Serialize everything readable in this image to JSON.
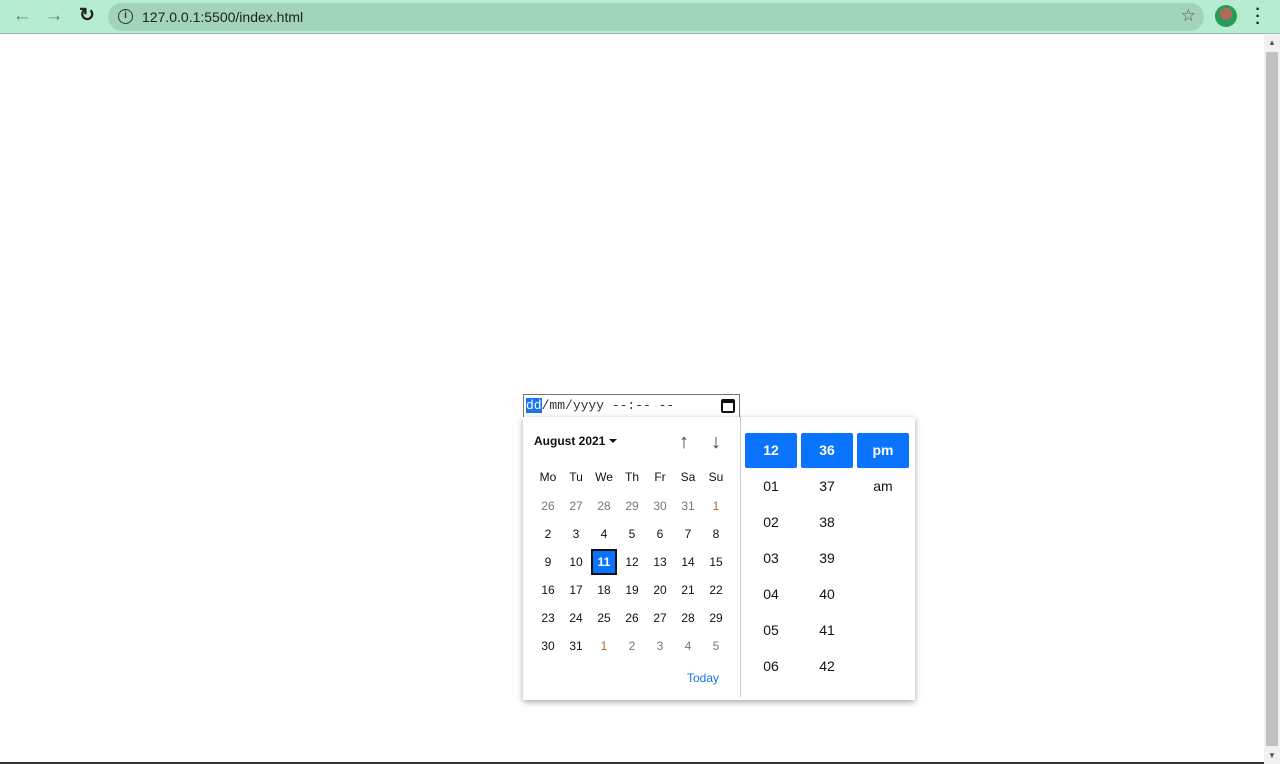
{
  "browser": {
    "url": "127.0.0.1:5500/index.html"
  },
  "input": {
    "day": "dd",
    "rest": "/mm/yyyy --:-- --"
  },
  "calendar": {
    "month_label": "August 2021",
    "weekdays": [
      "Mo",
      "Tu",
      "We",
      "Th",
      "Fr",
      "Sa",
      "Su"
    ],
    "weeks": [
      [
        {
          "d": "26",
          "t": "other"
        },
        {
          "d": "27",
          "t": "other"
        },
        {
          "d": "28",
          "t": "other"
        },
        {
          "d": "29",
          "t": "other"
        },
        {
          "d": "30",
          "t": "other"
        },
        {
          "d": "31",
          "t": "other"
        },
        {
          "d": "1",
          "t": "orange"
        }
      ],
      [
        {
          "d": "2"
        },
        {
          "d": "3"
        },
        {
          "d": "4"
        },
        {
          "d": "5"
        },
        {
          "d": "6"
        },
        {
          "d": "7"
        },
        {
          "d": "8"
        }
      ],
      [
        {
          "d": "9"
        },
        {
          "d": "10"
        },
        {
          "d": "11",
          "t": "sel"
        },
        {
          "d": "12"
        },
        {
          "d": "13"
        },
        {
          "d": "14"
        },
        {
          "d": "15"
        }
      ],
      [
        {
          "d": "16"
        },
        {
          "d": "17"
        },
        {
          "d": "18"
        },
        {
          "d": "19"
        },
        {
          "d": "20"
        },
        {
          "d": "21"
        },
        {
          "d": "22"
        }
      ],
      [
        {
          "d": "23"
        },
        {
          "d": "24"
        },
        {
          "d": "25"
        },
        {
          "d": "26"
        },
        {
          "d": "27"
        },
        {
          "d": "28"
        },
        {
          "d": "29"
        }
      ],
      [
        {
          "d": "30"
        },
        {
          "d": "31"
        },
        {
          "d": "1",
          "t": "orange"
        },
        {
          "d": "2",
          "t": "other"
        },
        {
          "d": "3",
          "t": "other"
        },
        {
          "d": "4",
          "t": "other"
        },
        {
          "d": "5",
          "t": "other"
        }
      ]
    ],
    "today_label": "Today"
  },
  "time": {
    "hours": [
      "12",
      "01",
      "02",
      "03",
      "04",
      "05",
      "06"
    ],
    "minutes": [
      "36",
      "37",
      "38",
      "39",
      "40",
      "41",
      "42"
    ],
    "ampm": [
      "pm",
      "am"
    ],
    "selected_index": 0
  },
  "colors": {
    "accent": "#0a74ff",
    "toolbar": "#b6ecd1"
  }
}
